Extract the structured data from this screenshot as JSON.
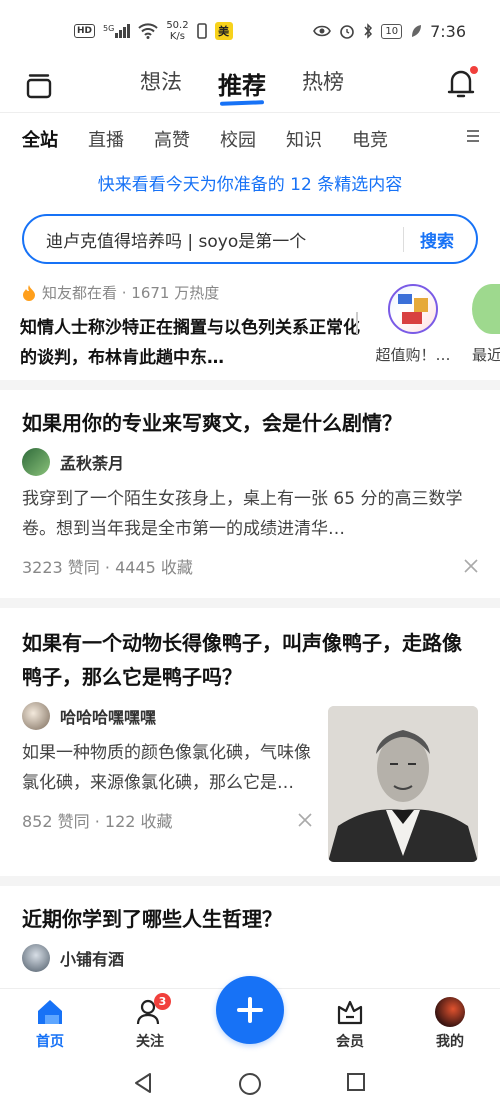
{
  "status_bar": {
    "hd": "HD",
    "net": "5G",
    "speed_value": "50.2",
    "speed_unit": "K/s",
    "meituan": "美",
    "battery": "10",
    "time": "7:36"
  },
  "top_nav": {
    "tabs": [
      "想法",
      "推荐",
      "热榜"
    ],
    "active_tab": "推荐"
  },
  "categories": [
    "全站",
    "直播",
    "高赞",
    "校园",
    "知识",
    "电竞"
  ],
  "banner": "快来看看今天为你准备的 12 条精选内容",
  "search": {
    "value": "迪卢克值得培养吗 | soyo是第一个",
    "button": "搜索"
  },
  "hot": {
    "meta": "知友都在看 · 1671 万热度",
    "title": "知情人士称沙特正在搁置与以色列关系正常化的谈判，布林肯此趟中东…",
    "side_items": [
      "超值购！…",
      "最近"
    ]
  },
  "cards": [
    {
      "question": "如果用你的专业来写爽文，会是什么剧情？",
      "author": "孟秋荼月",
      "excerpt": "我穿到了一个陌生女孩身上，桌上有一张 65 分的高三数学卷。想到当年我是全市第一的成绩进清华…",
      "stats": "3223 赞同 · 4445 收藏"
    },
    {
      "question": "如果有一个动物长得像鸭子，叫声像鸭子，走路像鸭子，那么它是鸭子吗？",
      "author": "哈哈哈嘿嘿嘿",
      "excerpt": "如果一种物质的颜色像氯化碘，气味像氯化碘，来源像氯化碘，那么它是…",
      "stats": "852 赞同 · 122 收藏"
    },
    {
      "question": "近期你学到了哪些人生哲理？",
      "author": "小铺有酒"
    }
  ],
  "bottom_nav": {
    "home": "首页",
    "follow": "关注",
    "follow_badge": "3",
    "vip": "会员",
    "me": "我的"
  },
  "colors": {
    "accent": "#1772f6",
    "badge": "#f1403c"
  }
}
